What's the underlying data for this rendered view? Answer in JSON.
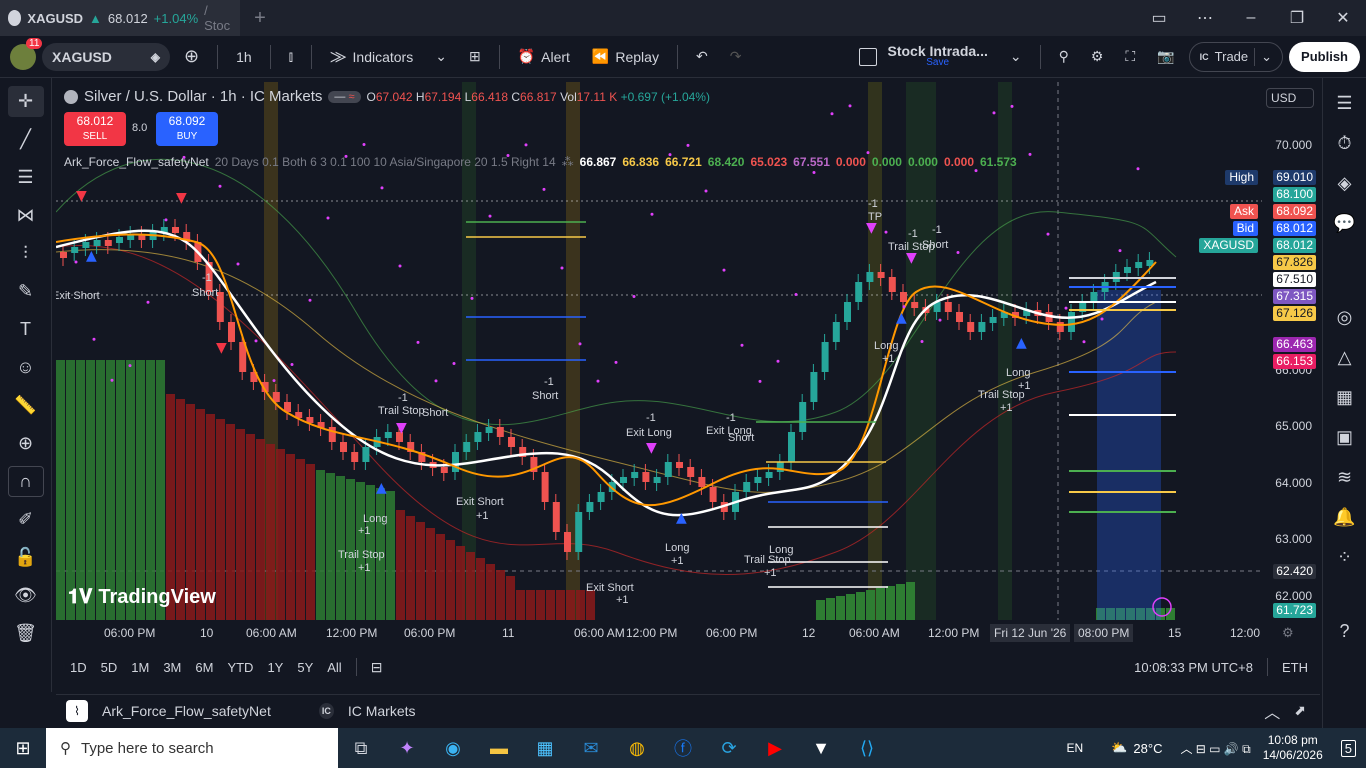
{
  "window": {
    "tab_title": "XAGUSD",
    "tab_price": "68.012",
    "tab_change": "+1.04%",
    "tab_suffix": "/ Stoc",
    "new_tab": "+"
  },
  "toolbar": {
    "notif_count": "11",
    "symbol": "XAGUSD",
    "interval": "1h",
    "indicators": "Indicators",
    "alert": "Alert",
    "replay": "Replay",
    "layout_name": "Stock Intrada...",
    "layout_save": "Save",
    "trade": "Trade",
    "publish": "Publish"
  },
  "legend": {
    "title": "Silver / U.S. Dollar · 1h · IC Markets",
    "o_label": "O",
    "o": "67.042",
    "h_label": "H",
    "h": "67.194",
    "l_label": "L",
    "l": "66.418",
    "c_label": "C",
    "c": "66.817",
    "vol_label": "Vol",
    "vol": "17.11 K",
    "change": "+0.697 (+1.04%)",
    "sell_price": "68.012",
    "sell": "SELL",
    "spread": "8.0",
    "buy_price": "68.092",
    "buy": "BUY",
    "indicator_name": "Ark_Force_Flow_safetyNet",
    "indicator_params": "20 Days 0.1 Both 6 3 0.1 100 10 Asia/Singapore 20 1.5 Right 14",
    "iv": [
      "66.867",
      "66.836",
      "66.721",
      "68.420",
      "65.023",
      "67.551",
      "0.000",
      "0.000",
      "0.000",
      "0.000",
      "61.573"
    ],
    "iv_colors": [
      "#ffffff",
      "#f7c948",
      "#f7c948",
      "#4caf50",
      "#ef5350",
      "#ba68c8",
      "#ef5350",
      "#4caf50",
      "#4caf50",
      "#ef5350",
      "#4caf50"
    ]
  },
  "price_axis": {
    "currency": "USD",
    "ticks": [
      "70.000",
      "66.000",
      "65.000",
      "64.000",
      "63.000",
      "62.000"
    ],
    "labels": [
      {
        "tag": "High",
        "value": "69.010",
        "color": "#1e3a6b"
      },
      {
        "tag": "",
        "value": "68.100",
        "color": "#26a69a"
      },
      {
        "tag": "Ask",
        "value": "68.092",
        "color": "#ef5350"
      },
      {
        "tag": "Bid",
        "value": "68.012",
        "color": "#2962ff"
      },
      {
        "tag": "XAGUSD",
        "value": "68.012",
        "color": "#26a69a"
      },
      {
        "tag": "",
        "value": "67.826",
        "color": "#f7c948"
      },
      {
        "tag": "",
        "value": "67.510",
        "color": "#ffffff"
      },
      {
        "tag": "",
        "value": "67.315",
        "color": "#7e57c2"
      },
      {
        "tag": "",
        "value": "67.126",
        "color": "#f7c948"
      },
      {
        "tag": "",
        "value": "66.463",
        "color": "#9c27b0"
      },
      {
        "tag": "",
        "value": "66.153",
        "color": "#e91e63"
      },
      {
        "tag": "",
        "value": "62.420",
        "color": "#2a2e39"
      },
      {
        "tag": "",
        "value": "61.723",
        "color": "#26a69a"
      }
    ]
  },
  "time_axis": {
    "ticks": [
      "06:00 PM",
      "10",
      "06:00 AM",
      "12:00 PM",
      "06:00 PM",
      "11",
      "06:00 AM",
      "12:00 PM",
      "06:00 PM",
      "12",
      "06:00 AM",
      "12:00 PM",
      "Fri 12 Jun '26",
      "08:00 PM",
      "15",
      "12:00"
    ]
  },
  "range_bar": {
    "ranges": [
      "1D",
      "5D",
      "1M",
      "3M",
      "6M",
      "YTD",
      "1Y",
      "5Y",
      "All"
    ],
    "clock": "10:08:33 PM UTC+8",
    "session": "ETH"
  },
  "bottom_tabs": {
    "script": "Ark_Force_Flow_safetyNet",
    "broker": "IC Markets"
  },
  "signals": [
    {
      "text": "Exit Short",
      "cls": "es1"
    },
    {
      "text": "-1",
      "cls": "s1a"
    },
    {
      "text": "Short",
      "cls": "s1"
    },
    {
      "text": "-1",
      "cls": "ts1a"
    },
    {
      "text": "Trail Stop",
      "cls": "ts1"
    },
    {
      "text": "Short",
      "cls": "s2"
    },
    {
      "text": "-1",
      "cls": "s3a"
    },
    {
      "text": "Short",
      "cls": "s3"
    },
    {
      "text": "Long",
      "cls": "l1"
    },
    {
      "text": "+1",
      "cls": "l1b"
    },
    {
      "text": "Trail Stop",
      "cls": "ts2"
    },
    {
      "text": "+1",
      "cls": "ts2b"
    },
    {
      "text": "Exit Short",
      "cls": "es2"
    },
    {
      "text": "+1",
      "cls": "es2b"
    },
    {
      "text": "-1",
      "cls": "el1a"
    },
    {
      "text": "Exit Long",
      "cls": "el1"
    },
    {
      "text": "-1",
      "cls": "el2a"
    },
    {
      "text": "Exit Long",
      "cls": "el2"
    },
    {
      "text": "Short",
      "cls": "s4"
    },
    {
      "text": "Long",
      "cls": "l2"
    },
    {
      "text": "+1",
      "cls": "l2b"
    },
    {
      "text": "Exit Short",
      "cls": "es3"
    },
    {
      "text": "+1",
      "cls": "es3b"
    },
    {
      "text": "Long",
      "cls": "l3"
    },
    {
      "text": "Trail Stop",
      "cls": "ts3"
    },
    {
      "text": "+1",
      "cls": "ts3b"
    },
    {
      "text": "-1",
      "cls": "tp1a"
    },
    {
      "text": "TP",
      "cls": "tp1"
    },
    {
      "text": "-1",
      "cls": "ts4a"
    },
    {
      "text": "Trail Stop",
      "cls": "ts4"
    },
    {
      "text": "-1",
      "cls": "s5a"
    },
    {
      "text": "Short",
      "cls": "s5"
    },
    {
      "text": "Long",
      "cls": "l4"
    },
    {
      "text": "+1",
      "cls": "l4b"
    },
    {
      "text": "Long",
      "cls": "l5"
    },
    {
      "text": "+1",
      "cls": "l5b"
    },
    {
      "text": "Trail Stop",
      "cls": "ts5"
    },
    {
      "text": "+1",
      "cls": "ts5b"
    }
  ],
  "watermark": "TradingView",
  "taskbar": {
    "search_placeholder": "Type here to search",
    "lang": "EN",
    "weather": "28°C",
    "time": "10:08 pm",
    "date": "14/06/2026",
    "notif": "5"
  }
}
